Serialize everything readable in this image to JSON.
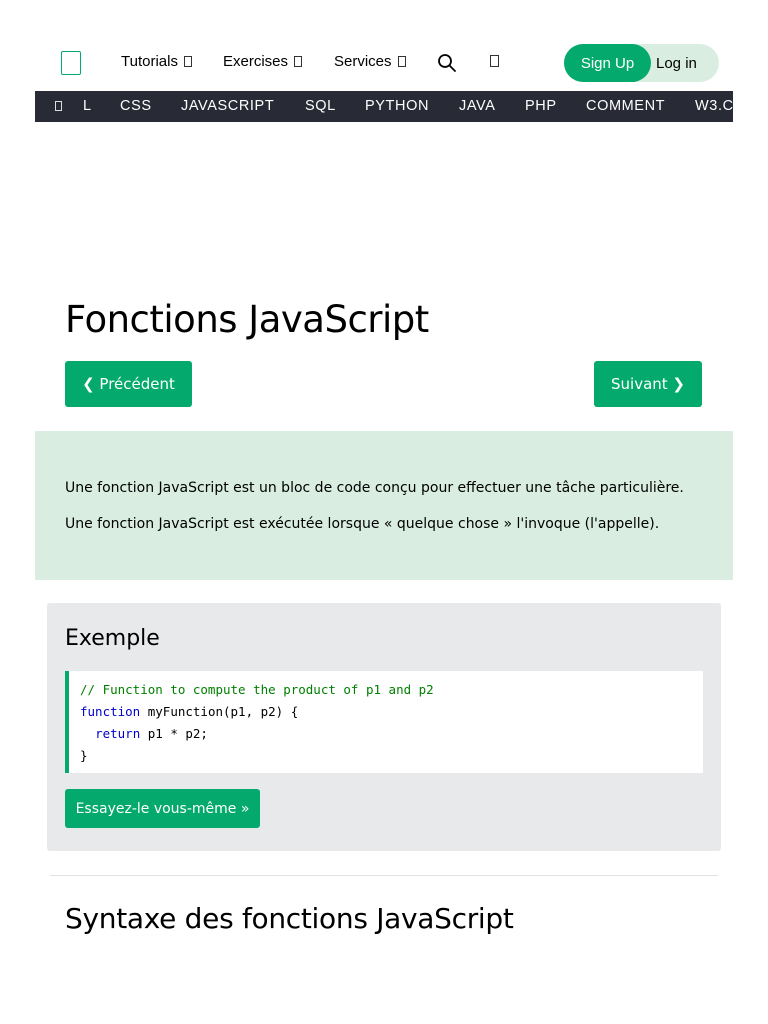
{
  "header": {
    "nav": [
      {
        "label": "Tutorials"
      },
      {
        "label": "Exercises"
      },
      {
        "label": "Services"
      }
    ],
    "signup_label": "Sign Up",
    "login_label": "Log in",
    "accent": "#04AA6D"
  },
  "subnav": {
    "items": [
      "L",
      "CSS",
      "JAVASCRIPT",
      "SQL",
      "PYTHON",
      "JAVA",
      "PHP",
      "COMMENT",
      "W3.C"
    ],
    "background": "#282A35"
  },
  "main": {
    "title": "Fonctions JavaScript",
    "prev_label": "❮ Précédent",
    "next_label": "Suivant ❯",
    "intro": [
      "Une fonction JavaScript est un bloc de code conçu pour effectuer une tâche particulière.",
      "Une fonction JavaScript est exécutée lorsque « quelque chose » l'invoque (l'appelle)."
    ],
    "example": {
      "heading": "Exemple",
      "code_comment": "// Function to compute the product of p1 and p2",
      "code_kw_function": "function",
      "code_line2_rest": " myFunction(p1, p2) {",
      "code_kw_return": "return",
      "code_line3_rest": " p1 * p2;",
      "code_line4": "}",
      "try_label": "Essayez-le vous-même »"
    },
    "section_title": "Syntaxe des fonctions JavaScript"
  }
}
